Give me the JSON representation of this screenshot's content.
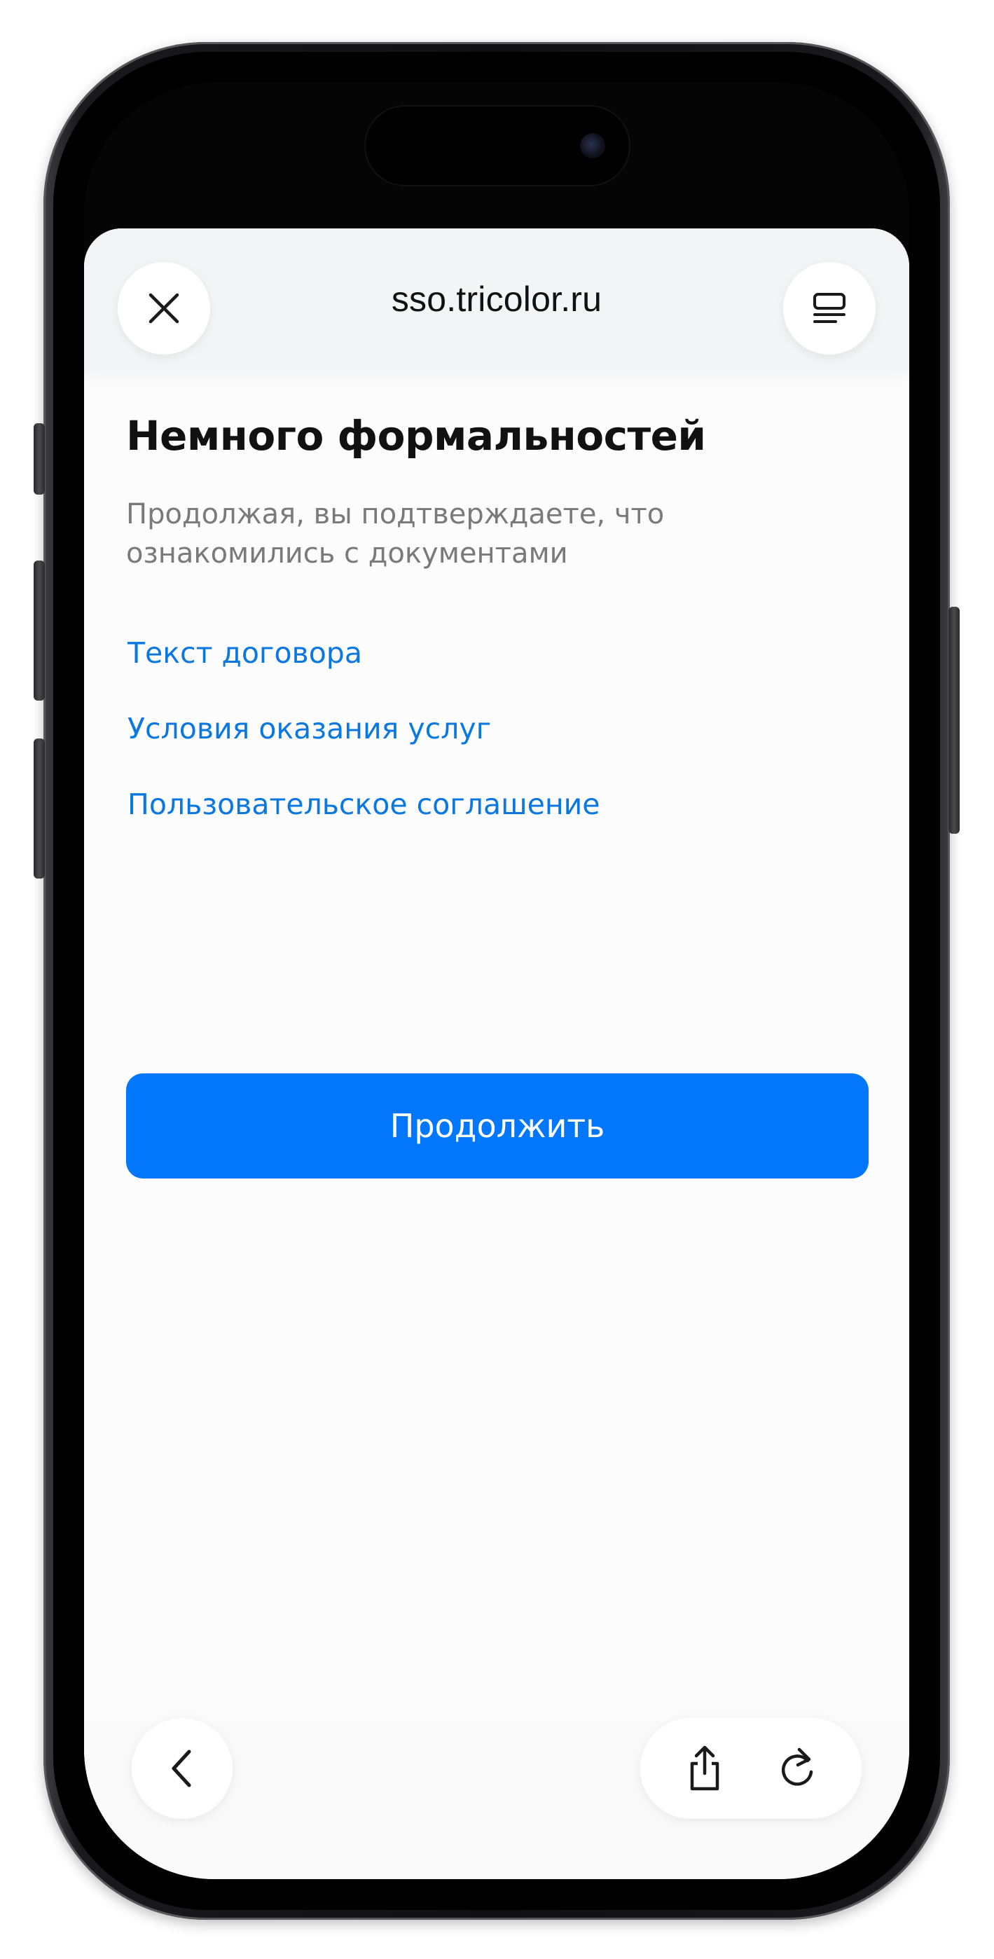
{
  "browser": {
    "url": "sso.tricolor.ru",
    "icons": {
      "close": "close-icon",
      "menu": "reader-menu-icon",
      "back": "chevron-left-icon",
      "share": "share-icon",
      "reload": "reload-icon"
    }
  },
  "page": {
    "title": "Немного формальностей",
    "subtitle": "Продолжая, вы подтверждаете, что ознакомились с документами",
    "links": [
      {
        "label": "Текст договора"
      },
      {
        "label": "Условия оказания услуг"
      },
      {
        "label": "Пользовательское соглашение"
      }
    ],
    "continue_button": "Продолжить"
  },
  "colors": {
    "accent": "#0277fc",
    "link": "#0a78e0",
    "title": "#111111",
    "subtitle": "#7a7a7a",
    "header_bg": "#f3f4f6",
    "page_bg": "#fcfcfc"
  }
}
